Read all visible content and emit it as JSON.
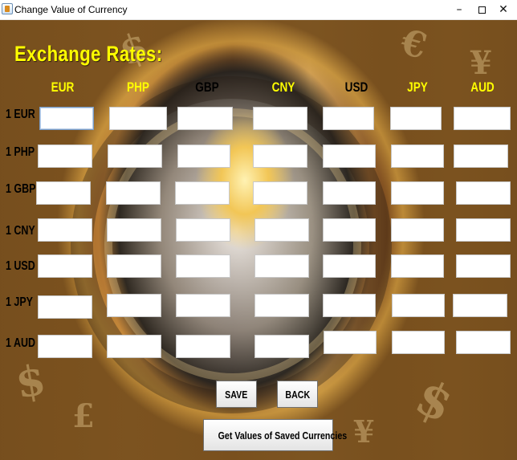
{
  "window": {
    "title": "Change Value of Currency",
    "controls": {
      "minimize": "–",
      "close": "✕"
    }
  },
  "heading": "Exchange Rates:",
  "columns": [
    "EUR",
    "PHP",
    "GBP",
    "CNY",
    "USD",
    "JPY",
    "AUD"
  ],
  "rows": [
    "1 EUR",
    "1 PHP",
    "1 GBP",
    "1 CNY",
    "1 USD",
    "1 JPY",
    "1 AUD"
  ],
  "rates": [
    [
      "",
      "",
      "",
      "",
      "",
      "",
      ""
    ],
    [
      "",
      "",
      "",
      "",
      "",
      "",
      ""
    ],
    [
      "",
      "",
      "",
      "",
      "",
      "",
      ""
    ],
    [
      "",
      "",
      "",
      "",
      "",
      "",
      ""
    ],
    [
      "",
      "",
      "",
      "",
      "",
      "",
      ""
    ],
    [
      "",
      "",
      "",
      "",
      "",
      "",
      ""
    ],
    [
      "",
      "",
      "",
      "",
      "",
      "",
      ""
    ]
  ],
  "buttons": {
    "save": "SAVE",
    "back": "BACK",
    "get_saved": "Get Values of Saved Currencies"
  },
  "colors": {
    "heading": "#ffff00",
    "column_header_yellow": "#ffff00",
    "column_header_dark": "#000000"
  },
  "background_glyphs": [
    "$",
    "€",
    "¥",
    "$",
    "£",
    "$",
    "¥"
  ]
}
